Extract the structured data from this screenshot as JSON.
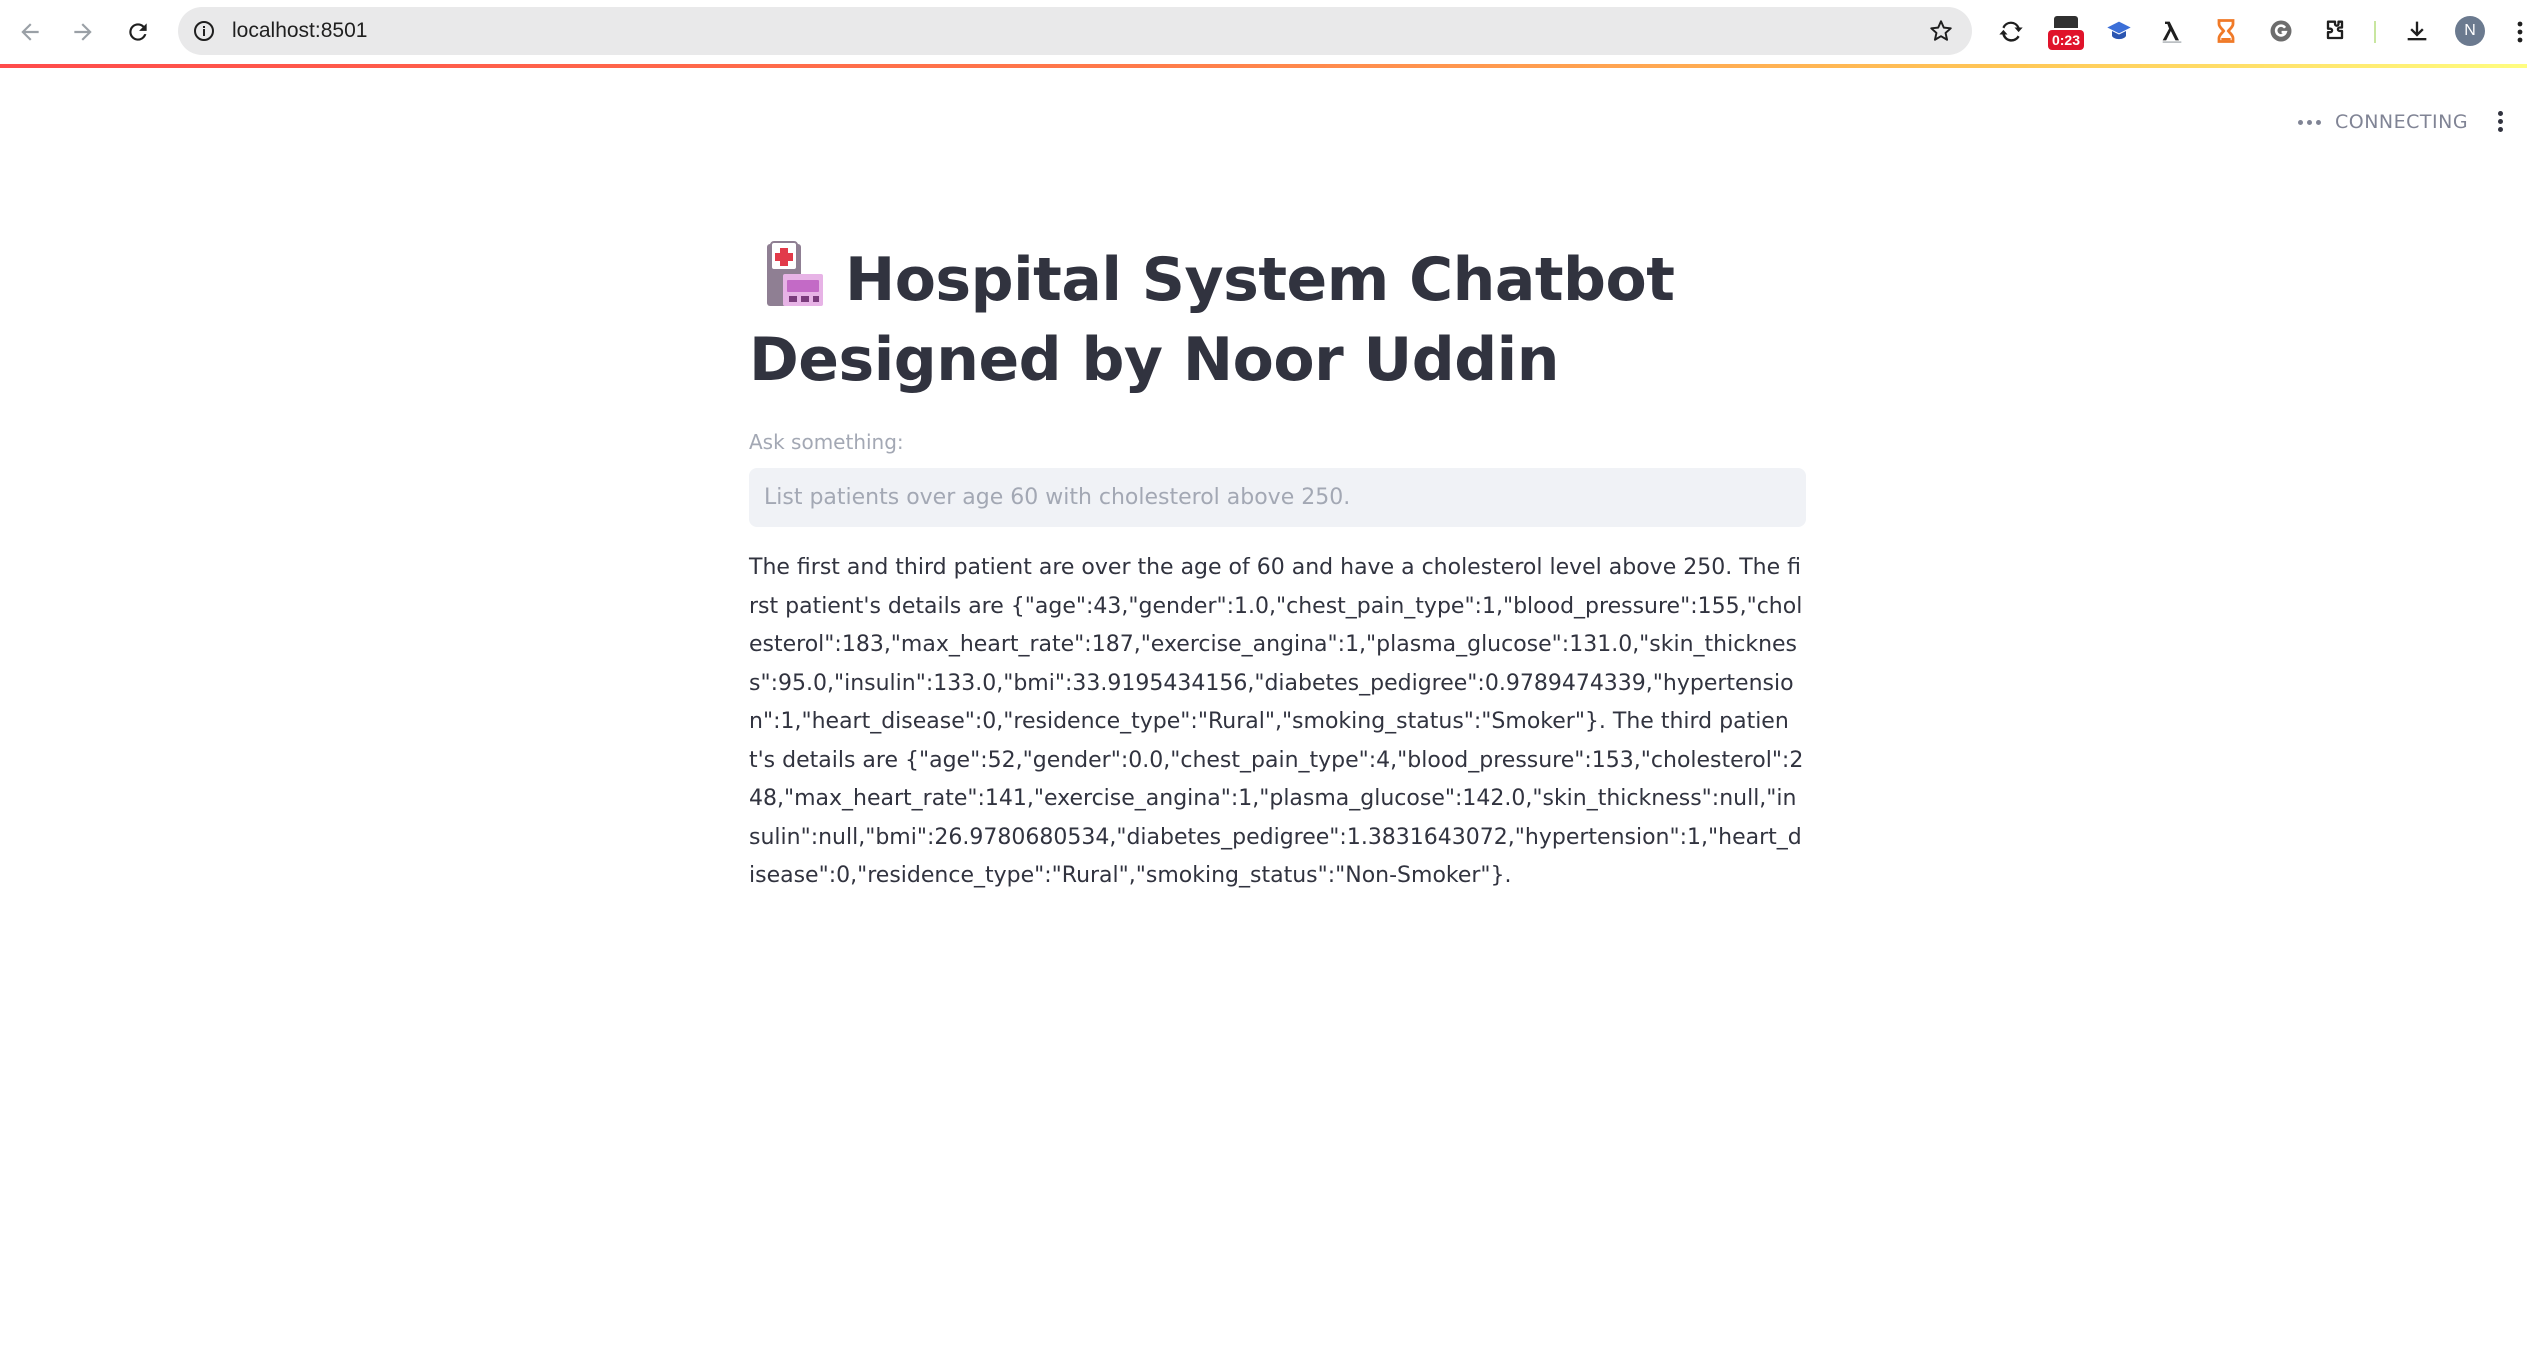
{
  "browser": {
    "url": "localhost:8501",
    "timer_extension_text": "0:23",
    "profile_initial": "N"
  },
  "app": {
    "status_text": "CONNECTING",
    "title_line1": "Hospital System Chatbot",
    "title_line2": "Designed by Noor Uddin",
    "input_label": "Ask something:",
    "input_placeholder": "List patients over age 60 with cholesterol above 250.",
    "response": "The first and third patient are over the age of 60 and have a cholesterol level above 250. The first patient's details are {\"age\":43,\"gender\":1.0,\"chest_pain_type\":1,\"blood_pressure\":155,\"cholesterol\":183,\"max_heart_rate\":187,\"exercise_angina\":1,\"plasma_glucose\":131.0,\"skin_thickness\":95.0,\"insulin\":133.0,\"bmi\":33.9195434156,\"diabetes_pedigree\":0.9789474339,\"hypertension\":1,\"heart_disease\":0,\"residence_type\":\"Rural\",\"smoking_status\":\"Smoker\"}. The third patient's details are {\"age\":52,\"gender\":0.0,\"chest_pain_type\":4,\"blood_pressure\":153,\"cholesterol\":248,\"max_heart_rate\":141,\"exercise_angina\":1,\"plasma_glucose\":142.0,\"skin_thickness\":null,\"insulin\":null,\"bmi\":26.9780680534,\"diabetes_pedigree\":1.3831643072,\"hypertension\":1,\"heart_disease\":0,\"residence_type\":\"Rural\",\"smoking_status\":\"Non-Smoker\"}."
  },
  "colors": {
    "accent": "#ff4b4b",
    "text": "#31333f",
    "muted": "#a3a8b4",
    "input_bg": "#f0f2f6"
  }
}
